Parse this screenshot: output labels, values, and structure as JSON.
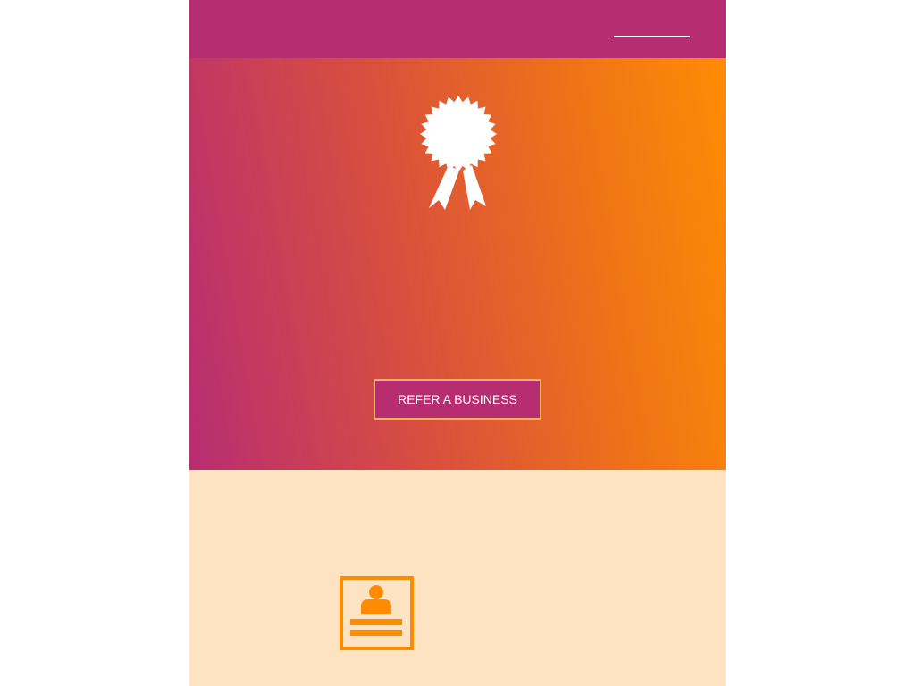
{
  "header": {
    "nav_link_label": ""
  },
  "hero": {
    "icon": "award-ribbon-icon",
    "button_label": "REFER A BUSINESS"
  },
  "lower": {
    "icon": "contact-card-icon"
  },
  "colors": {
    "brand_magenta": "#b72d72",
    "brand_orange": "#ff8b05",
    "button_border": "#f6b15c",
    "lower_background": "#fde3c1",
    "icon_orange": "#ff8c00"
  }
}
